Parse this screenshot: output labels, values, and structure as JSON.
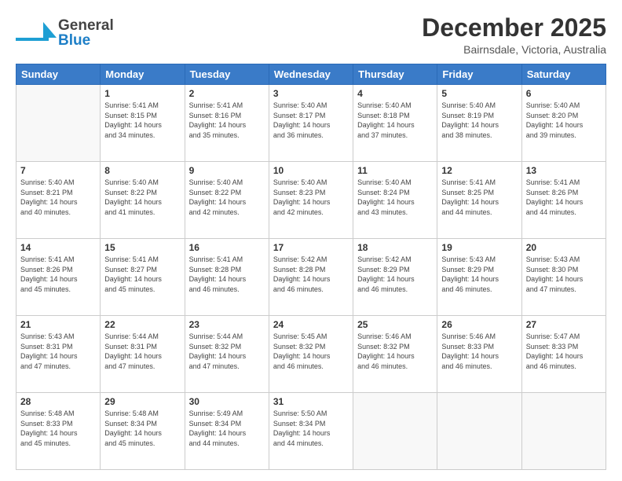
{
  "header": {
    "logo_general": "General",
    "logo_blue": "Blue",
    "month_title": "December 2025",
    "location": "Bairnsdale, Victoria, Australia"
  },
  "days_of_week": [
    "Sunday",
    "Monday",
    "Tuesday",
    "Wednesday",
    "Thursday",
    "Friday",
    "Saturday"
  ],
  "weeks": [
    [
      {
        "day": "",
        "info": ""
      },
      {
        "day": "1",
        "info": "Sunrise: 5:41 AM\nSunset: 8:15 PM\nDaylight: 14 hours\nand 34 minutes."
      },
      {
        "day": "2",
        "info": "Sunrise: 5:41 AM\nSunset: 8:16 PM\nDaylight: 14 hours\nand 35 minutes."
      },
      {
        "day": "3",
        "info": "Sunrise: 5:40 AM\nSunset: 8:17 PM\nDaylight: 14 hours\nand 36 minutes."
      },
      {
        "day": "4",
        "info": "Sunrise: 5:40 AM\nSunset: 8:18 PM\nDaylight: 14 hours\nand 37 minutes."
      },
      {
        "day": "5",
        "info": "Sunrise: 5:40 AM\nSunset: 8:19 PM\nDaylight: 14 hours\nand 38 minutes."
      },
      {
        "day": "6",
        "info": "Sunrise: 5:40 AM\nSunset: 8:20 PM\nDaylight: 14 hours\nand 39 minutes."
      }
    ],
    [
      {
        "day": "7",
        "info": "Sunrise: 5:40 AM\nSunset: 8:21 PM\nDaylight: 14 hours\nand 40 minutes."
      },
      {
        "day": "8",
        "info": "Sunrise: 5:40 AM\nSunset: 8:22 PM\nDaylight: 14 hours\nand 41 minutes."
      },
      {
        "day": "9",
        "info": "Sunrise: 5:40 AM\nSunset: 8:22 PM\nDaylight: 14 hours\nand 42 minutes."
      },
      {
        "day": "10",
        "info": "Sunrise: 5:40 AM\nSunset: 8:23 PM\nDaylight: 14 hours\nand 42 minutes."
      },
      {
        "day": "11",
        "info": "Sunrise: 5:40 AM\nSunset: 8:24 PM\nDaylight: 14 hours\nand 43 minutes."
      },
      {
        "day": "12",
        "info": "Sunrise: 5:41 AM\nSunset: 8:25 PM\nDaylight: 14 hours\nand 44 minutes."
      },
      {
        "day": "13",
        "info": "Sunrise: 5:41 AM\nSunset: 8:26 PM\nDaylight: 14 hours\nand 44 minutes."
      }
    ],
    [
      {
        "day": "14",
        "info": "Sunrise: 5:41 AM\nSunset: 8:26 PM\nDaylight: 14 hours\nand 45 minutes."
      },
      {
        "day": "15",
        "info": "Sunrise: 5:41 AM\nSunset: 8:27 PM\nDaylight: 14 hours\nand 45 minutes."
      },
      {
        "day": "16",
        "info": "Sunrise: 5:41 AM\nSunset: 8:28 PM\nDaylight: 14 hours\nand 46 minutes."
      },
      {
        "day": "17",
        "info": "Sunrise: 5:42 AM\nSunset: 8:28 PM\nDaylight: 14 hours\nand 46 minutes."
      },
      {
        "day": "18",
        "info": "Sunrise: 5:42 AM\nSunset: 8:29 PM\nDaylight: 14 hours\nand 46 minutes."
      },
      {
        "day": "19",
        "info": "Sunrise: 5:43 AM\nSunset: 8:29 PM\nDaylight: 14 hours\nand 46 minutes."
      },
      {
        "day": "20",
        "info": "Sunrise: 5:43 AM\nSunset: 8:30 PM\nDaylight: 14 hours\nand 47 minutes."
      }
    ],
    [
      {
        "day": "21",
        "info": "Sunrise: 5:43 AM\nSunset: 8:31 PM\nDaylight: 14 hours\nand 47 minutes."
      },
      {
        "day": "22",
        "info": "Sunrise: 5:44 AM\nSunset: 8:31 PM\nDaylight: 14 hours\nand 47 minutes."
      },
      {
        "day": "23",
        "info": "Sunrise: 5:44 AM\nSunset: 8:32 PM\nDaylight: 14 hours\nand 47 minutes."
      },
      {
        "day": "24",
        "info": "Sunrise: 5:45 AM\nSunset: 8:32 PM\nDaylight: 14 hours\nand 46 minutes."
      },
      {
        "day": "25",
        "info": "Sunrise: 5:46 AM\nSunset: 8:32 PM\nDaylight: 14 hours\nand 46 minutes."
      },
      {
        "day": "26",
        "info": "Sunrise: 5:46 AM\nSunset: 8:33 PM\nDaylight: 14 hours\nand 46 minutes."
      },
      {
        "day": "27",
        "info": "Sunrise: 5:47 AM\nSunset: 8:33 PM\nDaylight: 14 hours\nand 46 minutes."
      }
    ],
    [
      {
        "day": "28",
        "info": "Sunrise: 5:48 AM\nSunset: 8:33 PM\nDaylight: 14 hours\nand 45 minutes."
      },
      {
        "day": "29",
        "info": "Sunrise: 5:48 AM\nSunset: 8:34 PM\nDaylight: 14 hours\nand 45 minutes."
      },
      {
        "day": "30",
        "info": "Sunrise: 5:49 AM\nSunset: 8:34 PM\nDaylight: 14 hours\nand 44 minutes."
      },
      {
        "day": "31",
        "info": "Sunrise: 5:50 AM\nSunset: 8:34 PM\nDaylight: 14 hours\nand 44 minutes."
      },
      {
        "day": "",
        "info": ""
      },
      {
        "day": "",
        "info": ""
      },
      {
        "day": "",
        "info": ""
      }
    ]
  ]
}
